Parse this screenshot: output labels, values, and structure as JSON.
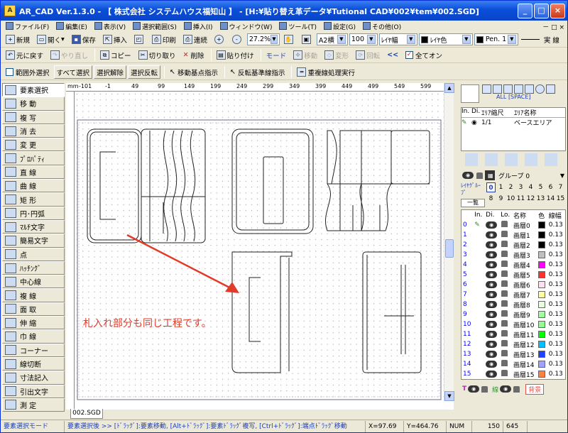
{
  "window": {
    "title": "AR_CAD Ver.1.3.0 - 【 株式会社 システムハウス福知山 】 - [H:¥貼り替え革データ¥Tutional CAD¥002¥tem¥002.SGD]"
  },
  "menu": [
    "ファイル(F)",
    "編集(E)",
    "表示(V)",
    "選択範囲(S)",
    "挿入(I)",
    "ウィンドウ(W)",
    "ツール(T)",
    "設定(G)",
    "その他(O)"
  ],
  "toolbar1": {
    "new": "新規",
    "open": "開く",
    "save": "保存",
    "insert": "挿入",
    "print": "印刷",
    "continuous": "連続",
    "zoom": "27.2%",
    "paper": "A2横",
    "scale": "100",
    "layer_width": "ﾚｲﾔ幅",
    "layer_color": "ﾚｲﾔ色",
    "pen": "Pen. 1",
    "line_type": "実 線"
  },
  "toolbar2": {
    "undo": "元に戻す",
    "redo": "やり直し",
    "copy": "コピー",
    "cut": "切り取り",
    "delete": "削除",
    "paste": "貼り付け",
    "mode": "モード",
    "move": "移動",
    "deform": "変形",
    "rotate": "回転",
    "all_on": "全てオン"
  },
  "toolbar3": {
    "outside": "範囲外選択",
    "select_all": "すべて選択",
    "deselect": "選択解除",
    "invert": "選択反転",
    "move_base": "移動基点指示",
    "flip_base": "反転基準線指示",
    "dup_line": "重複線処理実行"
  },
  "tools": [
    "要素選択",
    "移 動",
    "複 写",
    "消 去",
    "変 更",
    "ﾌﾟﾛﾊﾟﾃｨ",
    "直 線",
    "曲 線",
    "矩 形",
    "円･円弧",
    "ﾏﾙﾁ文字",
    "簡易文字",
    "点",
    "ﾊｯﾁﾝｸﾞ",
    "中心線",
    "複 線",
    "面 取",
    "伸 縮",
    "巾 線",
    "コーナー",
    "線切断",
    "寸法記入",
    "引出文字",
    "測 定"
  ],
  "tool_icons": [
    "select-icon",
    "move-icon",
    "copy-icon",
    "erase-icon",
    "change-icon",
    "property-icon",
    "line-icon",
    "curve-icon",
    "rect-icon",
    "circle-icon",
    "multitext-icon",
    "text-icon",
    "point-icon",
    "hatch-icon",
    "centerline-icon",
    "offset-icon",
    "chamfer-icon",
    "extend-icon",
    "width-icon",
    "corner-icon",
    "cut-icon",
    "dimension-icon",
    "leader-icon",
    "measure-icon"
  ],
  "ruler": {
    "unit": "mm",
    "top": [
      "-101",
      "-1",
      "49",
      "99",
      "149",
      "199",
      "249",
      "299",
      "349",
      "399",
      "449",
      "499",
      "549",
      "599"
    ]
  },
  "canvas": {
    "annotation": "札入れ部分も同じ工程です。",
    "annotation_color": "#e23b2a",
    "file_tab": "002.SGD"
  },
  "snap": {
    "all": "ALL",
    "space": "[SPACE]"
  },
  "area": {
    "headers": [
      "In.",
      "Di.",
      "ｴﾘｱ縮尺",
      "ｴﾘｱ名称"
    ],
    "scale": "1/1",
    "name": "ベースエリア"
  },
  "group": {
    "label": "グループ 0",
    "layer_group": "ﾚｲﾔｸﾞﾙｰﾌﾟ",
    "list": "一覧",
    "nums_row1": [
      "0",
      "1",
      "2",
      "3",
      "4",
      "5",
      "6",
      "7"
    ],
    "nums_row2": [
      "8",
      "9",
      "10",
      "11",
      "12",
      "13",
      "14",
      "15"
    ]
  },
  "layers": {
    "headers": [
      "In.",
      "Di.",
      "Lo.",
      "名称",
      "色",
      "線幅"
    ],
    "rows": [
      {
        "n": "0",
        "name": "画層0",
        "color": "#000000",
        "w": "0.13"
      },
      {
        "n": "1",
        "name": "画層1",
        "color": "#000000",
        "w": "0.13"
      },
      {
        "n": "2",
        "name": "画層2",
        "color": "#000000",
        "w": "0.13"
      },
      {
        "n": "3",
        "name": "画層3",
        "color": "#c0c0c0",
        "w": "0.13"
      },
      {
        "n": "4",
        "name": "画層4",
        "color": "#ff00ff",
        "w": "0.13"
      },
      {
        "n": "5",
        "name": "画層5",
        "color": "#ff3030",
        "w": "0.13"
      },
      {
        "n": "6",
        "name": "画層6",
        "color": "#ffe0f0",
        "w": "0.13"
      },
      {
        "n": "7",
        "name": "画層7",
        "color": "#ffffa0",
        "w": "0.13"
      },
      {
        "n": "8",
        "name": "画層8",
        "color": "#e8ffe0",
        "w": "0.13"
      },
      {
        "n": "9",
        "name": "画層9",
        "color": "#a0ffa0",
        "w": "0.13"
      },
      {
        "n": "10",
        "name": "画層10",
        "color": "#90ff90",
        "w": "0.13"
      },
      {
        "n": "11",
        "name": "画層11",
        "color": "#00ff00",
        "w": "0.13"
      },
      {
        "n": "12",
        "name": "画層12",
        "color": "#00c0ff",
        "w": "0.13"
      },
      {
        "n": "13",
        "name": "画層13",
        "color": "#2040ff",
        "w": "0.13"
      },
      {
        "n": "14",
        "name": "画層14",
        "color": "#a0a0ff",
        "w": "0.13"
      },
      {
        "n": "15",
        "name": "画層15",
        "color": "#ff8040",
        "w": "0.13"
      }
    ]
  },
  "bottom_right": {
    "t": "T",
    "line": "線",
    "bg": "背景"
  },
  "status": {
    "mode": "要素選択モード",
    "hint": "要素選択後 >> [ﾄﾞﾗｯｸﾞ]:要素移動, [Alt+ﾄﾞﾗｯｸﾞ]:要素ﾄﾞﾗｯｸﾞ複写, [Ctrl+ﾄﾞﾗｯｸﾞ]:端点ﾄﾞﾗｯｸﾞ移動",
    "x": "X=97.69",
    "y": "Y=464.76",
    "num": "NUM",
    "v1": "150",
    "v2": "645"
  }
}
